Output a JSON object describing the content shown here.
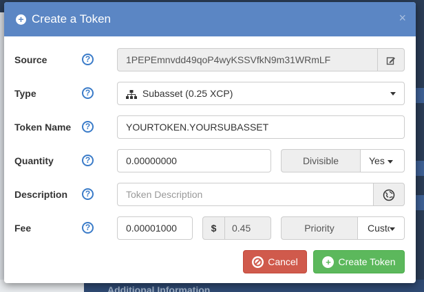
{
  "modal": {
    "title": "Create a Token",
    "close": "×",
    "help_glyph": "?"
  },
  "fields": {
    "source": {
      "label": "Source",
      "value": "1PEPEmnvdd49qoP4wyKSSVfkN9m31WRmLF"
    },
    "type": {
      "label": "Type",
      "value": "Subasset (0.25 XCP)"
    },
    "token_name": {
      "label": "Token Name",
      "value": "YOURTOKEN.YOURSUBASSET"
    },
    "quantity": {
      "label": "Quantity",
      "value": "0.00000000",
      "divisible_label": "Divisible",
      "divisible_value": "Yes"
    },
    "description": {
      "label": "Description",
      "placeholder": "Token Description"
    },
    "fee": {
      "label": "Fee",
      "value": "0.00001000",
      "usd_symbol": "$",
      "usd_value": "0.45",
      "priority_label": "Priority",
      "priority_value": "Custo"
    }
  },
  "buttons": {
    "cancel": "Cancel",
    "create": "Create Token"
  },
  "background": {
    "bottom_text": "Additional Information"
  },
  "colors": {
    "header": "#5b86c4",
    "cancel": "#d05a4c",
    "create": "#5cb85c",
    "help": "#3a7bc8"
  }
}
